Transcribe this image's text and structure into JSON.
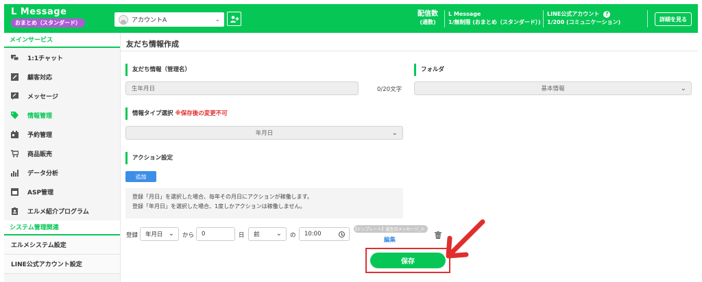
{
  "header": {
    "brand": "L Message",
    "plan_badge": "おまとめ（スタンダード）",
    "account": "アカウントA",
    "stats": {
      "delivery_label": "配信数",
      "delivery_sub": "(通数)",
      "lmessage_label": "L Message",
      "lmessage_value": "1/無制限 (おまとめ（スタンダード）)",
      "line_label": "LINE公式アカウント",
      "line_value": "1/200 (コミュニケーション)"
    },
    "detail_button": "詳細を見る",
    "brand_color": "#06c755"
  },
  "sidebar": {
    "section_main": "メインサービス",
    "items": [
      {
        "label": "1:1チャット",
        "icon": "chat-icon"
      },
      {
        "label": "顧客対応",
        "icon": "edit-icon"
      },
      {
        "label": "メッセージ",
        "icon": "message-icon"
      },
      {
        "label": "情報管理",
        "icon": "tag-icon"
      },
      {
        "label": "予約管理",
        "icon": "calendar-icon"
      },
      {
        "label": "商品販売",
        "icon": "cart-icon"
      },
      {
        "label": "データ分析",
        "icon": "chart-icon"
      },
      {
        "label": "ASP管理",
        "icon": "monitor-icon"
      },
      {
        "label": "エルメ紹介プログラム",
        "icon": "badge-icon"
      }
    ],
    "active_index": 3,
    "section_system": "システム管理関連",
    "system_items": [
      "エルメシステム設定",
      "LINE公式アカウント設定"
    ]
  },
  "main": {
    "page_title": "友だち情報作成",
    "info_name_label": "友だち情報（管理名）",
    "info_name_value": "生年月日",
    "char_count": "0/20文字",
    "folder_label": "フォルダ",
    "folder_value": "基本情報",
    "type_label": "情報タイプ選択",
    "type_warning": "※保存後の変更不可",
    "type_value": "年月日",
    "action_label": "アクション設定",
    "add_button": "追加",
    "note_line1": "登録「月日」を選択した場合、毎年その月日にアクションが稼働します。",
    "note_line2": "登録「年月日」を選択した場合、1度しかアクションは稼働しません。",
    "row": {
      "register": "登録",
      "unit_select": "年月日",
      "from": "から",
      "days_value": "0",
      "day_unit": "日",
      "direction": "前",
      "no": "の",
      "time": "10:00",
      "template_tag": "【テンプレート】誕生日メッセージ_テ...",
      "edit": "編集"
    },
    "save_button": "保存"
  }
}
